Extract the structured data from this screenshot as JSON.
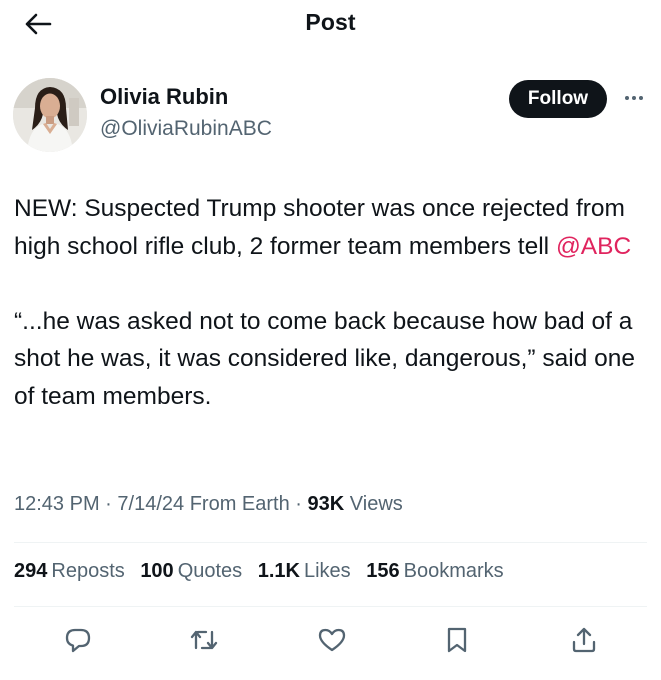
{
  "header": {
    "title": "Post"
  },
  "author": {
    "name": "Olivia Rubin",
    "handle": "@OliviaRubinABC",
    "follow_label": "Follow"
  },
  "tweet": {
    "line1_prefix": "NEW: Suspected Trump shooter was once rejected from high school rifle club, 2 former team members tell ",
    "mention": "@ABC",
    "line2": "“...he was asked not to come back because how bad of a shot he was, it was considered like, dangerous,” said one of team members."
  },
  "meta": {
    "time": "12:43 PM",
    "date": "7/14/24",
    "source": "From Earth",
    "views_count": "93K",
    "views_label": "Views",
    "separator": "·"
  },
  "stats": [
    {
      "count": "294",
      "label": "Reposts"
    },
    {
      "count": "100",
      "label": "Quotes"
    },
    {
      "count": "1.1K",
      "label": "Likes"
    },
    {
      "count": "156",
      "label": "Bookmarks"
    }
  ],
  "colors": {
    "text": "#0f1419",
    "secondary": "#536471",
    "mention": "#e0245e",
    "follow_bg": "#0f1419",
    "divider": "#eff3f4"
  },
  "icons": {
    "back": "arrow-left-icon",
    "more": "more-horizontal-icon",
    "reply": "reply-icon",
    "repost": "repost-icon",
    "like": "heart-icon",
    "bookmark": "bookmark-icon",
    "share": "share-icon"
  }
}
